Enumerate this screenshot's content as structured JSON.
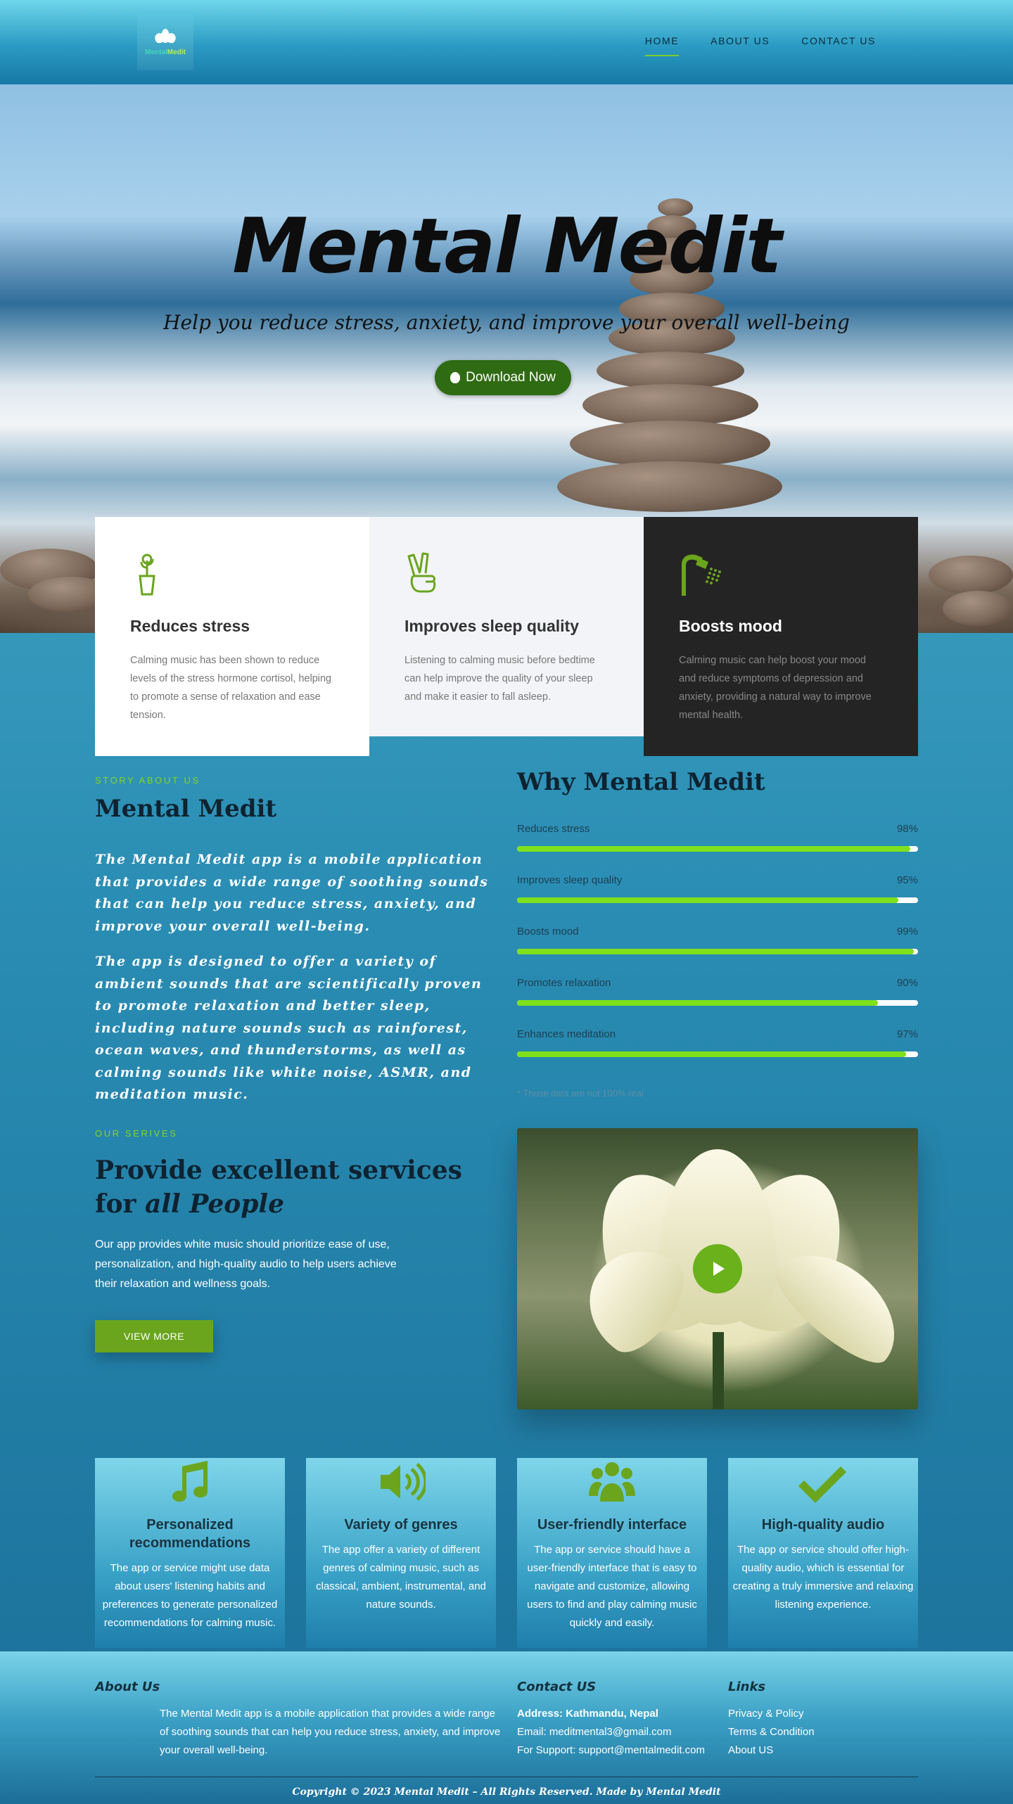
{
  "header": {
    "logo_text_a": "Mental",
    "logo_text_b": "Medit",
    "nav": [
      {
        "label": "HOME"
      },
      {
        "label": "ABOUT US"
      },
      {
        "label": "CONTACT US"
      }
    ]
  },
  "hero": {
    "title": "Mental Medit",
    "tagline": "Help you reduce stress, anxiety, and improve your overall well-being",
    "button_label": "Download Now"
  },
  "benefits": [
    {
      "icon": "cactus-icon",
      "title": "Reduces stress",
      "text": "Calming music has been shown to reduce levels of the stress hormone cortisol, helping to promote a sense of relaxation and ease tension."
    },
    {
      "icon": "peace-hand-icon",
      "title": "Improves sleep quality",
      "text": "Listening to calming music before bedtime can help improve the quality of your sleep and make it easier to fall asleep."
    },
    {
      "icon": "shower-icon",
      "title": "Boosts mood",
      "text": "Calming music can help boost your mood and reduce symptoms of depression and anxiety, providing a natural way to improve mental health."
    }
  ],
  "story": {
    "eyebrow": "STORY ABOUT US",
    "title": "Mental Medit",
    "p1": "The Mental Medit app is a mobile application that provides a wide range of soothing sounds that can help you reduce stress, anxiety, and improve your overall well-being.",
    "p2": "The app is designed to offer a variety of ambient sounds that are scientifically proven to promote relaxation and better sleep, including nature sounds such as rainforest, ocean waves, and thunderstorms, as well as calming sounds like white noise, ASMR, and meditation music."
  },
  "why": {
    "title": "Why Mental Medit",
    "skills": [
      {
        "label": "Reduces stress",
        "percent_text": "98%",
        "value": 98
      },
      {
        "label": "Improves sleep quality",
        "percent_text": "95%",
        "value": 95
      },
      {
        "label": "Boosts mood",
        "percent_text": "99%",
        "value": 99
      },
      {
        "label": "Promotes relaxation",
        "percent_text": "90%",
        "value": 90
      },
      {
        "label": "Enhances meditation",
        "percent_text": "97%",
        "value": 97
      }
    ],
    "note": "* Those data are not 100% real"
  },
  "services": {
    "eyebrow": "OUR SERIVES",
    "title_line1": "Provide excellent services",
    "title_for": "for ",
    "title_emph": "all People",
    "text": "Our app provides white music should prioritize ease of use, personalization, and high-quality audio to help users achieve their relaxation and wellness goals.",
    "button_label": "VIEW MORE"
  },
  "features": [
    {
      "icon": "music-note-icon",
      "title": "Personalized recommendations",
      "text": "The app or service might use data about users' listening habits and preferences to generate personalized recommendations for calming music."
    },
    {
      "icon": "speaker-volume-icon",
      "title": "Variety of genres",
      "text": "The app offer a variety of different genres of calming music, such as classical, ambient, instrumental, and nature sounds."
    },
    {
      "icon": "users-group-icon",
      "title": "User-friendly interface",
      "text": "The app or service should have a user-friendly interface that is easy to navigate and customize, allowing users to find and play calming music quickly and easily."
    },
    {
      "icon": "checkmark-icon",
      "title": "High-quality audio",
      "text": "The app or service should offer high-quality audio, which is essential for creating a truly immersive and relaxing listening experience."
    }
  ],
  "footer": {
    "about_title": "About Us",
    "about_text": "The Mental Medit app is a mobile application that provides a wide range of soothing sounds that can help you reduce stress, anxiety, and improve your overall well-being.",
    "contact_title": "Contact US",
    "address": "Address: Kathmandu, Nepal",
    "email": "Email: meditmental3@gmail.com",
    "support": "For Support: support@mentalmedit.com",
    "links_title": "Links",
    "links": [
      {
        "label": "Privacy & Policy"
      },
      {
        "label": "Terms & Condition"
      },
      {
        "label": "About US"
      }
    ],
    "copyright": "Copyright © 2023 Mental Medit – All Rights Reserved. Made by Mental Medit"
  },
  "colors": {
    "accent_green": "#7fe11b",
    "button_green": "#2f6b12",
    "background_blue": "#2a8db3"
  }
}
